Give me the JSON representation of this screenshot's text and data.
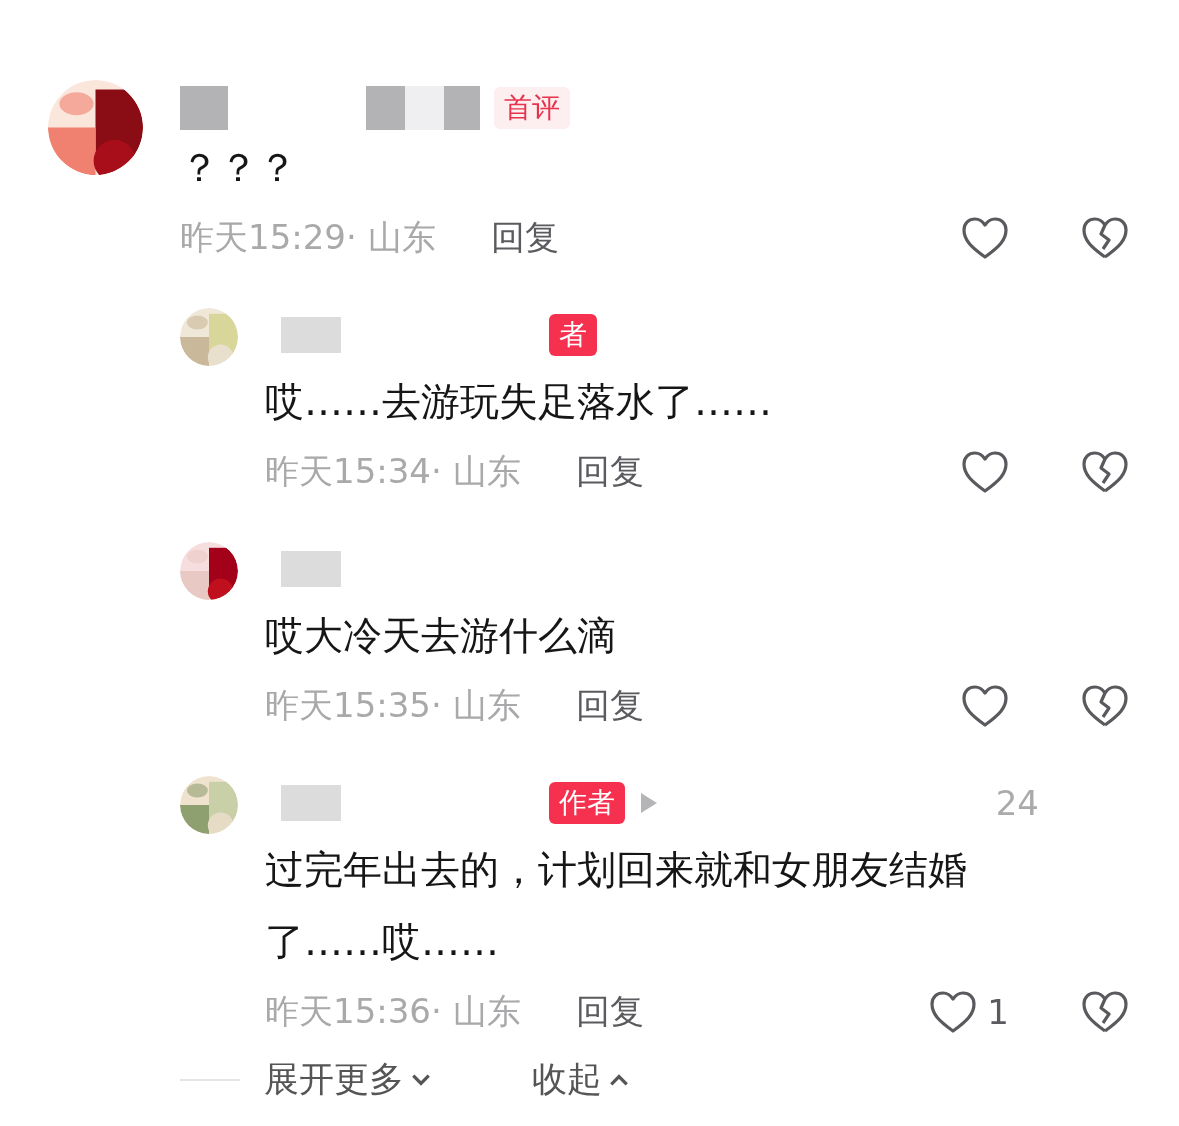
{
  "comments": [
    {
      "kind": "top",
      "badge": {
        "text": "首评",
        "kind": "first"
      },
      "text": "？？？",
      "time": "昨天15:29· 山东",
      "reply": "回复"
    },
    {
      "kind": "reply",
      "badge": {
        "text": "者",
        "kind": "author"
      },
      "text": "哎……去游玩失足落水了……",
      "time": "昨天15:34· 山东",
      "reply": "回复"
    },
    {
      "kind": "reply",
      "text": "哎大冷天去游什么滴",
      "time": "昨天15:35· 山东",
      "reply": "回复"
    },
    {
      "kind": "reply",
      "badge": {
        "text": "作者",
        "kind": "author"
      },
      "arrow": true,
      "extra": "24",
      "text": "过完年出去的，计划回来就和女朋友结婚了……哎……",
      "time": "昨天15:36· 山东",
      "reply": "回复",
      "likes": "1"
    }
  ],
  "footer": {
    "expand": "展开更多",
    "collapse": "收起"
  }
}
